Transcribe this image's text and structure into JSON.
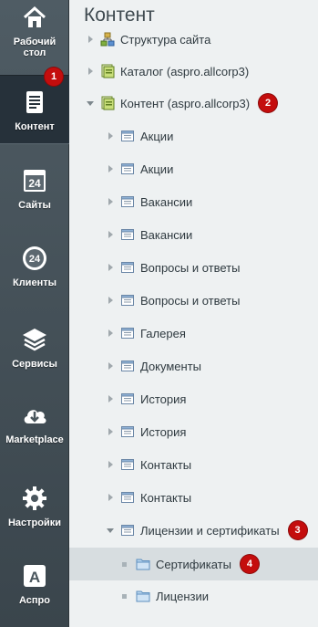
{
  "sidebar": {
    "items": [
      {
        "label_1": "Рабочий",
        "label_2": "стол",
        "icon": "home-icon"
      },
      {
        "label": "Контент",
        "icon": "document-icon",
        "badge": "1"
      },
      {
        "label": "Сайты",
        "icon": "calendar-24-icon"
      },
      {
        "label": "Клиенты",
        "icon": "clients-24-icon"
      },
      {
        "label": "Сервисы",
        "icon": "layers-icon"
      },
      {
        "label": "Marketplace",
        "icon": "cloud-download-icon"
      },
      {
        "label": "Настройки",
        "icon": "gear-icon"
      },
      {
        "label": "Аспро",
        "icon": "aspro-a-icon"
      }
    ]
  },
  "main": {
    "title": "Контент",
    "tree": [
      {
        "label": "Структура сайта",
        "icon": "site-structure-icon",
        "expanded": false
      },
      {
        "label": "Каталог (aspro.allcorp3)",
        "icon": "catalog-icon",
        "expanded": false
      },
      {
        "label": "Контент (aspro.allcorp3)",
        "icon": "catalog-icon",
        "expanded": true,
        "badge": "2"
      },
      {
        "label": "Акции",
        "icon": "list-icon"
      },
      {
        "label": "Акции",
        "icon": "list-icon"
      },
      {
        "label": "Вакансии",
        "icon": "list-icon"
      },
      {
        "label": "Вакансии",
        "icon": "list-icon"
      },
      {
        "label": "Вопросы и ответы",
        "icon": "list-icon"
      },
      {
        "label": "Вопросы и ответы",
        "icon": "list-icon"
      },
      {
        "label": "Галерея",
        "icon": "list-icon"
      },
      {
        "label": "Документы",
        "icon": "list-icon"
      },
      {
        "label": "История",
        "icon": "list-icon"
      },
      {
        "label": "История",
        "icon": "list-icon"
      },
      {
        "label": "Контакты",
        "icon": "list-icon"
      },
      {
        "label": "Контакты",
        "icon": "list-icon"
      },
      {
        "label": "Лицензии и сертификаты",
        "icon": "list-icon",
        "expanded": true,
        "badge": "3"
      },
      {
        "label": "Сертификаты",
        "icon": "folder-icon",
        "selected": true,
        "badge": "4"
      },
      {
        "label": "Лицензии",
        "icon": "folder-icon"
      }
    ]
  }
}
